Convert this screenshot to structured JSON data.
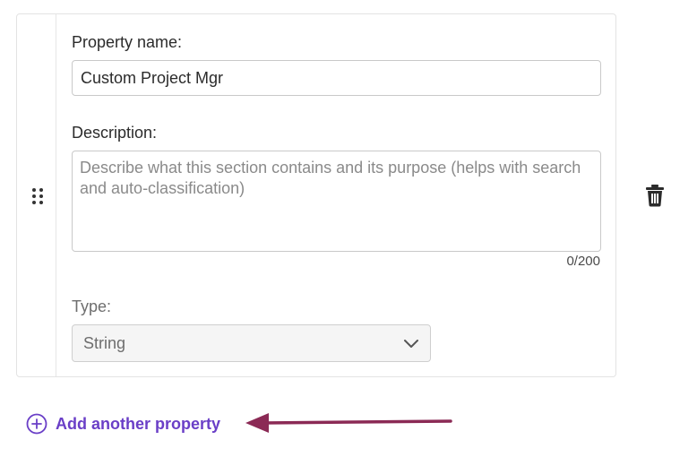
{
  "property": {
    "name_label": "Property name:",
    "name_value": "Custom Project Mgr",
    "description_label": "Description:",
    "description_placeholder": "Describe what this section contains and its purpose (helps with search and auto-classification)",
    "description_counter": "0/200",
    "type_label": "Type:",
    "type_value": "String"
  },
  "actions": {
    "add_property_label": "Add another property"
  },
  "icons": {
    "drag": "drag-handle-icon",
    "delete": "trash-icon",
    "chevron": "chevron-down-icon",
    "add": "plus-circle-icon",
    "annotation_arrow": "arrow-left-icon"
  },
  "colors": {
    "accent": "#6a3fc7",
    "annotation_arrow": "#8b2a55"
  }
}
